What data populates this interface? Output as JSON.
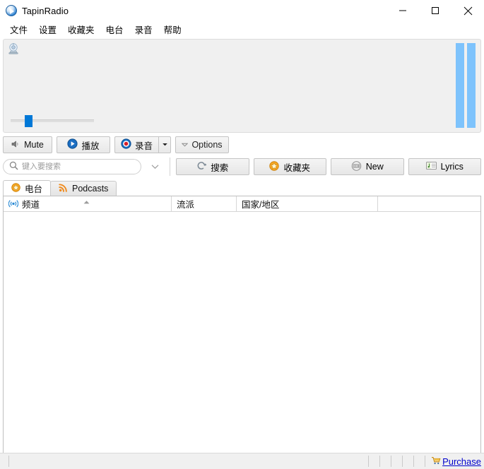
{
  "window": {
    "title": "TapinRadio",
    "app_icon": "play-circle-icon",
    "minimize_label": "minimize",
    "maximize_label": "maximize",
    "close_label": "close"
  },
  "menubar": {
    "items": [
      {
        "label": "文件"
      },
      {
        "label": "设置"
      },
      {
        "label": "收藏夹"
      },
      {
        "label": "电台"
      },
      {
        "label": "录音"
      },
      {
        "label": "帮助"
      }
    ]
  },
  "player": {
    "station_icon": "satellite-dish-icon",
    "volume": {
      "value": 18,
      "min": 0,
      "max": 100
    },
    "vu_meter": {
      "bars": 2,
      "level": 100,
      "color": "#7ec3fc"
    }
  },
  "transport": {
    "mute_label": "Mute",
    "play_label": "播放",
    "record_label": "录音",
    "record_dropdown_label": "▼",
    "options_label": "Options"
  },
  "search": {
    "placeholder": "键入要搜索",
    "value": "",
    "history_dropdown_label": "▼",
    "search_button_label": "搜索",
    "favorites_button_label": "收藏夹",
    "new_button_label": "New",
    "lyrics_button_label": "Lyrics"
  },
  "tabs": [
    {
      "label": "电台",
      "icon": "star-icon",
      "active": true
    },
    {
      "label": "Podcasts",
      "icon": "rss-icon",
      "active": false
    }
  ],
  "list": {
    "columns": [
      {
        "label": "频道",
        "icon": "broadcast-icon",
        "sorted": "asc"
      },
      {
        "label": "流派",
        "icon": "",
        "sorted": ""
      },
      {
        "label": "国家/地区",
        "icon": "",
        "sorted": ""
      }
    ],
    "rows": []
  },
  "statusbar": {
    "message": "",
    "purchase_label": "Purchase",
    "purchase_icon": "cart-icon",
    "link_color": "#0000cc"
  }
}
